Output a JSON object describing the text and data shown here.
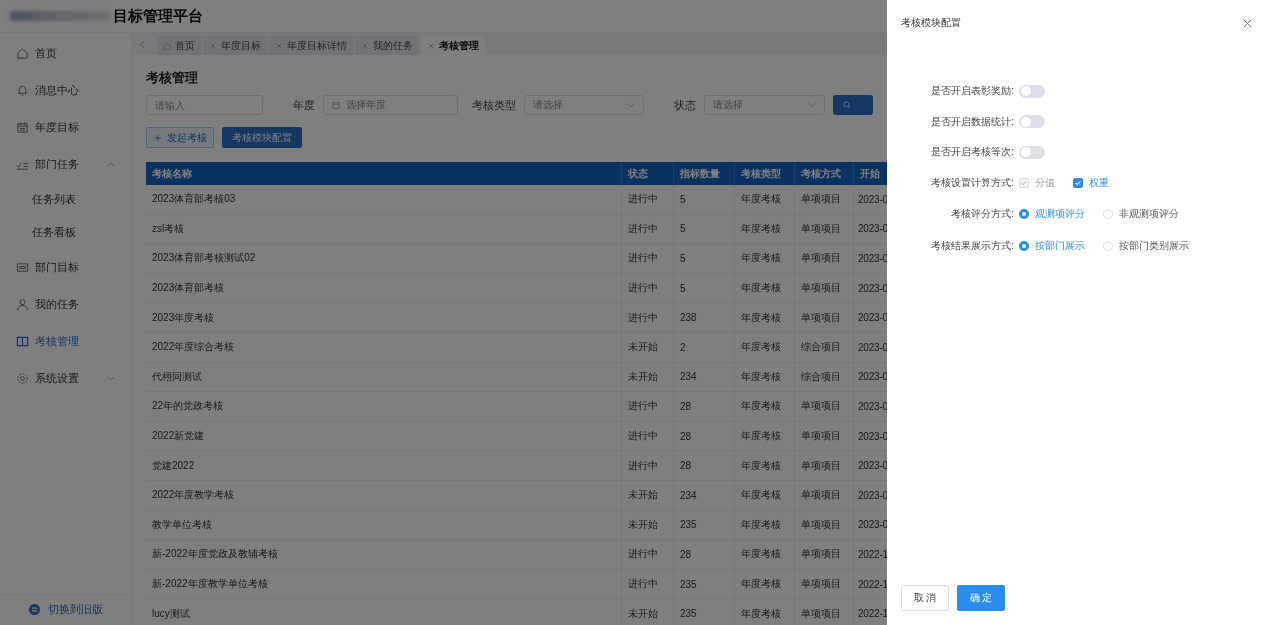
{
  "header": {
    "title": "目标管理平台"
  },
  "sidebar": {
    "items": [
      {
        "label": "首页",
        "selected": false
      },
      {
        "label": "消息中心",
        "selected": false
      },
      {
        "label": "年度目标",
        "selected": false
      },
      {
        "label": "部门任务",
        "selected": false,
        "expanded": true,
        "children": [
          {
            "label": "任务列表",
            "selected": false
          },
          {
            "label": "任务看板",
            "selected": false
          }
        ]
      },
      {
        "label": "部门目标",
        "selected": false
      },
      {
        "label": "我的任务",
        "selected": false
      },
      {
        "label": "考核管理",
        "selected": true
      },
      {
        "label": "系统设置",
        "selected": false,
        "expanded": false
      }
    ],
    "footer_link": "切换到旧版"
  },
  "tabs": [
    {
      "label": "首页",
      "kind": "home",
      "selected": false
    },
    {
      "label": "年度目标",
      "kind": "closable",
      "selected": false
    },
    {
      "label": "年度目标详情",
      "kind": "closable",
      "selected": false
    },
    {
      "label": "我的任务",
      "kind": "closable",
      "selected": false
    },
    {
      "label": "考核管理",
      "kind": "closable",
      "selected": true
    }
  ],
  "page": {
    "title": "考核管理",
    "filters": [
      {
        "kind": "input",
        "placeholder": "请输入"
      },
      {
        "kind": "date",
        "label": "年度",
        "placeholder": "选择年度"
      },
      {
        "kind": "select",
        "label": "考核类型",
        "placeholder": "请选择"
      },
      {
        "kind": "select",
        "label": "状态",
        "placeholder": "请选择"
      }
    ],
    "buttons": [
      {
        "label": "发起考核",
        "kind": "plain"
      },
      {
        "label": "考核模块配置",
        "kind": "primary"
      }
    ],
    "table": {
      "columns": [
        "考核名称",
        "状态",
        "指标数量",
        "考核类型",
        "考核方式",
        "开始"
      ],
      "rows": [
        [
          "2023体育部考核03",
          "进行中",
          "5",
          "年度考核",
          "单项项目",
          "2023-0"
        ],
        [
          "zsl考核",
          "进行中",
          "5",
          "年度考核",
          "单项项目",
          "2023-0"
        ],
        [
          "2023体育部考核测试02",
          "进行中",
          "5",
          "年度考核",
          "单项项目",
          "2023-0"
        ],
        [
          "2023体育部考核",
          "进行中",
          "5",
          "年度考核",
          "单项项目",
          "2023-0"
        ],
        [
          "2023年度考核",
          "进行中",
          "238",
          "年度考核",
          "单项项目",
          "2023-0"
        ],
        [
          "2022年度综合考核",
          "未开始",
          "2",
          "年度考核",
          "综合项目",
          "2023-0"
        ],
        [
          "代栩同测试",
          "未开始",
          "234",
          "年度考核",
          "综合项目",
          "2023-0"
        ],
        [
          "22年的党政考核",
          "进行中",
          "28",
          "年度考核",
          "单项项目",
          "2023-0"
        ],
        [
          "2022新党建",
          "进行中",
          "28",
          "年度考核",
          "单项项目",
          "2023-0"
        ],
        [
          "党建2022",
          "进行中",
          "28",
          "年度考核",
          "单项项目",
          "2023-0"
        ],
        [
          "2022年度教学考核",
          "未开始",
          "234",
          "年度考核",
          "单项项目",
          "2023-0"
        ],
        [
          "教学单位考核",
          "未开始",
          "235",
          "年度考核",
          "单项项目",
          "2023-0"
        ],
        [
          "新-2022年度党政及教辅考核",
          "进行中",
          "28",
          "年度考核",
          "单项项目",
          "2022-1"
        ],
        [
          "新-2022年度教学单位考核",
          "进行中",
          "235",
          "年度考核",
          "单项项目",
          "2022-1"
        ],
        [
          "lucy测试",
          "未开始",
          "235",
          "年度考核",
          "单项项目",
          "2022-1"
        ]
      ]
    }
  },
  "drawer": {
    "title": "考核模块配置",
    "fields": [
      {
        "kind": "switch",
        "label": "是否开启表彰奖励:",
        "on": false
      },
      {
        "kind": "switch",
        "label": "是否开启数据统计:",
        "on": false
      },
      {
        "kind": "switch",
        "label": "是否开启考核等次:",
        "on": false
      },
      {
        "kind": "checkboxes",
        "label": "考核设置计算方式:",
        "options": [
          {
            "label": "分值",
            "checked": true,
            "disabled": true
          },
          {
            "label": "权重",
            "checked": true,
            "disabled": false
          }
        ]
      },
      {
        "kind": "radios",
        "label": "考核评分方式:",
        "options": [
          {
            "label": "观测项评分",
            "selected": true
          },
          {
            "label": "非观测项评分",
            "selected": false
          }
        ]
      },
      {
        "kind": "radios",
        "label": "考核结果展示方式:",
        "options": [
          {
            "label": "按部门展示",
            "selected": true
          },
          {
            "label": "按部门类别展示",
            "selected": false
          }
        ]
      }
    ],
    "buttons": [
      {
        "label": "取 消",
        "kind": "plain"
      },
      {
        "label": "确 定",
        "kind": "primary"
      }
    ]
  }
}
